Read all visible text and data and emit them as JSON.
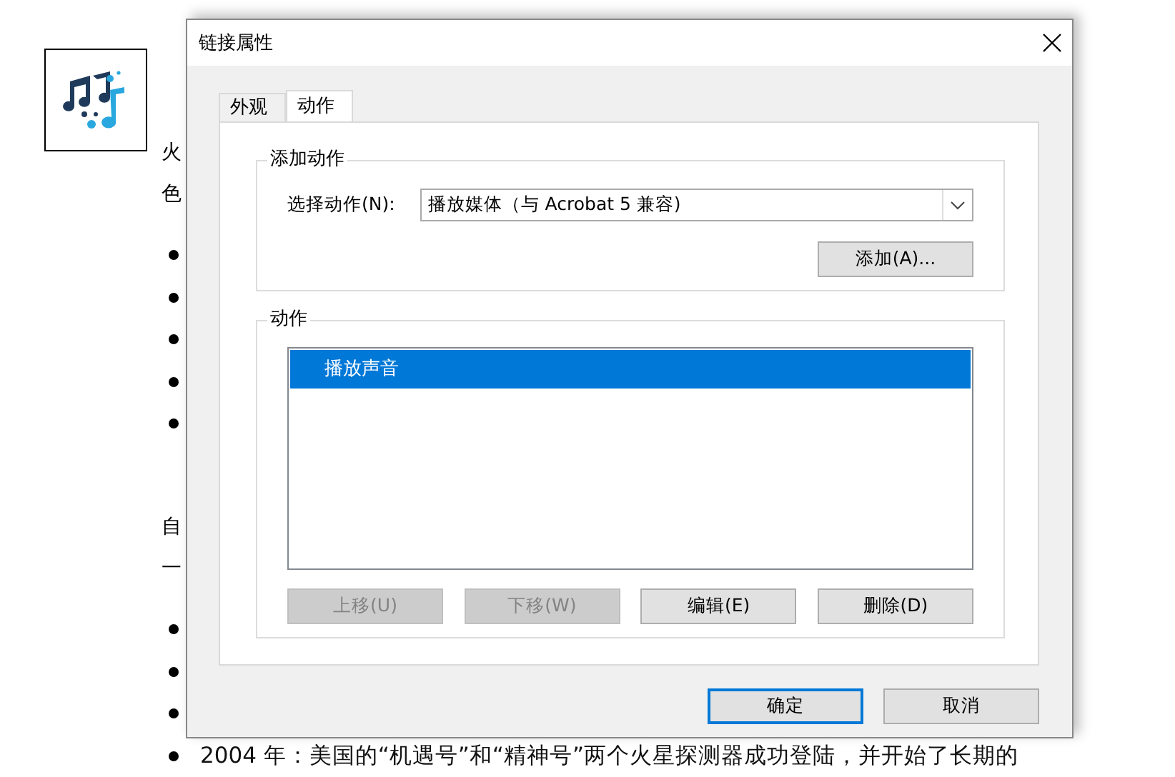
{
  "document": {
    "sections": [
      {
        "lines": [
          "火",
          "色"
        ],
        "bullets": [
          {
            "kind": "bullet"
          },
          {
            "kind": "bullet"
          },
          {
            "kind": "bullet"
          },
          {
            "kind": "bullet"
          },
          {
            "kind": "bullet"
          }
        ]
      },
      {
        "lines": [
          "自",
          "一"
        ],
        "bullets": [
          {
            "kind": "bullet"
          },
          {
            "kind": "bullet"
          },
          {
            "kind": "bullet"
          },
          {
            "kind": "bullet",
            "text": "2004 年：美国的“机遇号”和“精神号”两个火星探测器成功登陆，并开始了长期的"
          }
        ]
      }
    ]
  },
  "dialog": {
    "title": "链接属性",
    "tabs": [
      {
        "label": "外观",
        "selected": false
      },
      {
        "label": "动作",
        "selected": true
      }
    ],
    "add_group": {
      "title": "添加动作",
      "select_label": "选择动作(N):",
      "select_value": "播放媒体（与 Acrobat 5 兼容)",
      "add_button": "添加(A)..."
    },
    "actions_group": {
      "title": "动作",
      "items": [
        {
          "label": "播放声音",
          "selected": true
        }
      ],
      "buttons": [
        {
          "label": "上移(U)",
          "disabled": true
        },
        {
          "label": "下移(W)",
          "disabled": true
        },
        {
          "label": "编辑(E)",
          "disabled": false
        },
        {
          "label": "删除(D)",
          "disabled": false
        }
      ]
    },
    "footer_buttons": [
      {
        "label": "确定",
        "default": true
      },
      {
        "label": "取消",
        "default": false
      }
    ]
  }
}
